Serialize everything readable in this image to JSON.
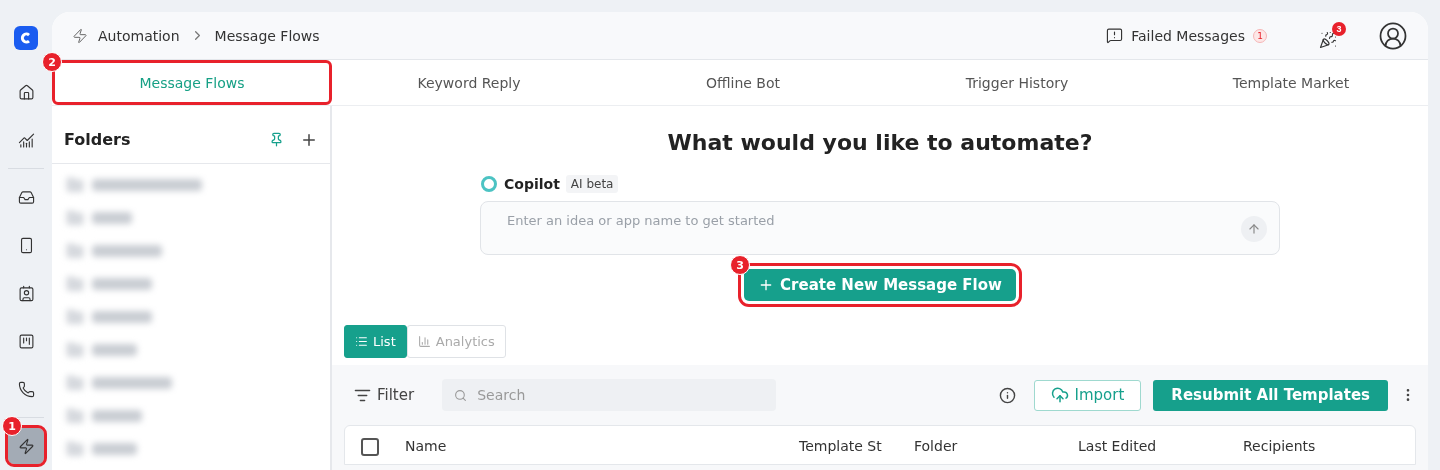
{
  "rail": {
    "items": [
      {
        "kind": "home",
        "selected": false
      },
      {
        "kind": "chart",
        "selected": false
      },
      {
        "kind": "divider"
      },
      {
        "kind": "inbox",
        "selected": false
      },
      {
        "kind": "device",
        "selected": false
      },
      {
        "kind": "contact",
        "selected": false
      },
      {
        "kind": "board",
        "selected": false
      },
      {
        "kind": "phone",
        "selected": false
      },
      {
        "kind": "divider"
      },
      {
        "kind": "bolt",
        "selected": true,
        "callout": "1"
      }
    ]
  },
  "breadcrumb": [
    "Automation",
    "Message Flows"
  ],
  "header": {
    "failed_label": "Failed Messages",
    "failed_count": "1",
    "notification_count": "3"
  },
  "tabs": [
    {
      "label": "Message Flows",
      "selected": true,
      "callout": "2"
    },
    {
      "label": "Keyword Reply",
      "selected": false
    },
    {
      "label": "Offline Bot",
      "selected": false
    },
    {
      "label": "Trigger History",
      "selected": false
    },
    {
      "label": "Template Market",
      "selected": false
    }
  ],
  "folders": {
    "title": "Folders"
  },
  "hero": {
    "title": "What would you like to automate?",
    "copilot": "Copilot",
    "copilot_badge": "AI beta",
    "placeholder": "Enter an idea or app name to get started",
    "create_button": "Create New Message Flow",
    "create_callout": "3"
  },
  "views": [
    {
      "label": "List",
      "selected": true
    },
    {
      "label": "Analytics",
      "selected": false
    }
  ],
  "toolbar": {
    "filter": "Filter",
    "search_placeholder": "Search",
    "import": "Import",
    "resubmit": "Resubmit All Templates"
  },
  "table": {
    "checked": false,
    "columns": [
      "Name",
      "Template St",
      "Folder",
      "Last Edited",
      "Recipients"
    ]
  }
}
